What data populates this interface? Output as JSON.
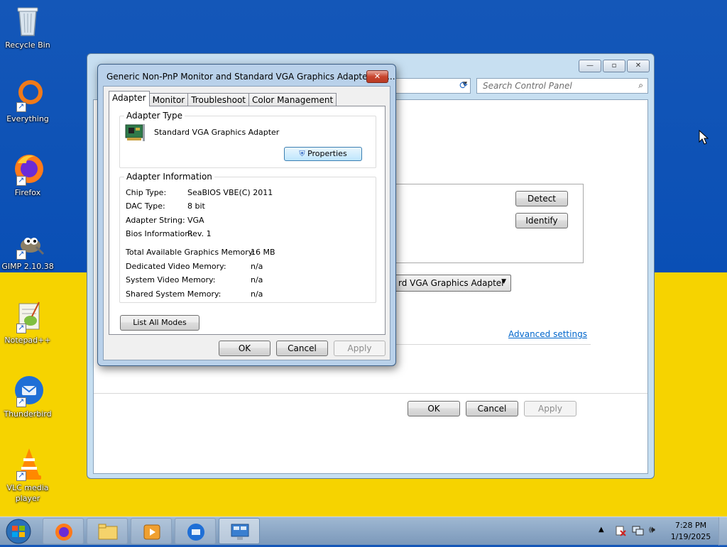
{
  "desktop": {
    "icons": [
      {
        "label": "Recycle Bin",
        "icon": "recycle-bin-icon"
      },
      {
        "label": "Everything",
        "icon": "everything-icon"
      },
      {
        "label": "Firefox",
        "icon": "firefox-icon"
      },
      {
        "label": "GIMP 2.10.38",
        "icon": "gimp-icon"
      },
      {
        "label": "Notepad++",
        "icon": "notepadpp-icon"
      },
      {
        "label": "Thunderbird",
        "icon": "thunderbird-icon"
      },
      {
        "label": "VLC media player",
        "icon": "vlc-icon"
      }
    ]
  },
  "control_panel": {
    "search_placeholder": "Search Control Panel",
    "detect_label": "Detect",
    "identify_label": "Identify",
    "display_dropdown": "rd VGA Graphics Adapter",
    "advanced_link": "Advanced settings",
    "ok_label": "OK",
    "cancel_label": "Cancel",
    "apply_label": "Apply"
  },
  "dialog": {
    "title": "Generic Non-PnP Monitor and Standard VGA Graphics Adapter Pro...",
    "close_label": "✕",
    "tabs": [
      {
        "label": "Adapter"
      },
      {
        "label": "Monitor"
      },
      {
        "label": "Troubleshoot"
      },
      {
        "label": "Color Management"
      }
    ],
    "adapter_type": {
      "group_label": "Adapter Type",
      "name": "Standard VGA Graphics Adapter",
      "properties_label": "Properties"
    },
    "adapter_info": {
      "group_label": "Adapter Information",
      "chip_type_label": "Chip Type:",
      "chip_type_value": "SeaBIOS VBE(C) 2011",
      "dac_type_label": "DAC Type:",
      "dac_type_value": "8 bit",
      "adapter_string_label": "Adapter String:",
      "adapter_string_value": "VGA",
      "bios_info_label": "Bios Information:",
      "bios_info_value": "Rev. 1",
      "total_mem_label": "Total Available Graphics Memory:",
      "total_mem_value": "16 MB",
      "dedicated_mem_label": "Dedicated Video Memory:",
      "dedicated_mem_value": "n/a",
      "system_mem_label": "System Video Memory:",
      "system_mem_value": "n/a",
      "shared_mem_label": "Shared System Memory:",
      "shared_mem_value": "n/a"
    },
    "list_all_modes_label": "List All Modes",
    "ok_label": "OK",
    "cancel_label": "Cancel",
    "apply_label": "Apply"
  },
  "taskbar": {
    "time": "7:28 PM",
    "date": "1/19/2025"
  }
}
